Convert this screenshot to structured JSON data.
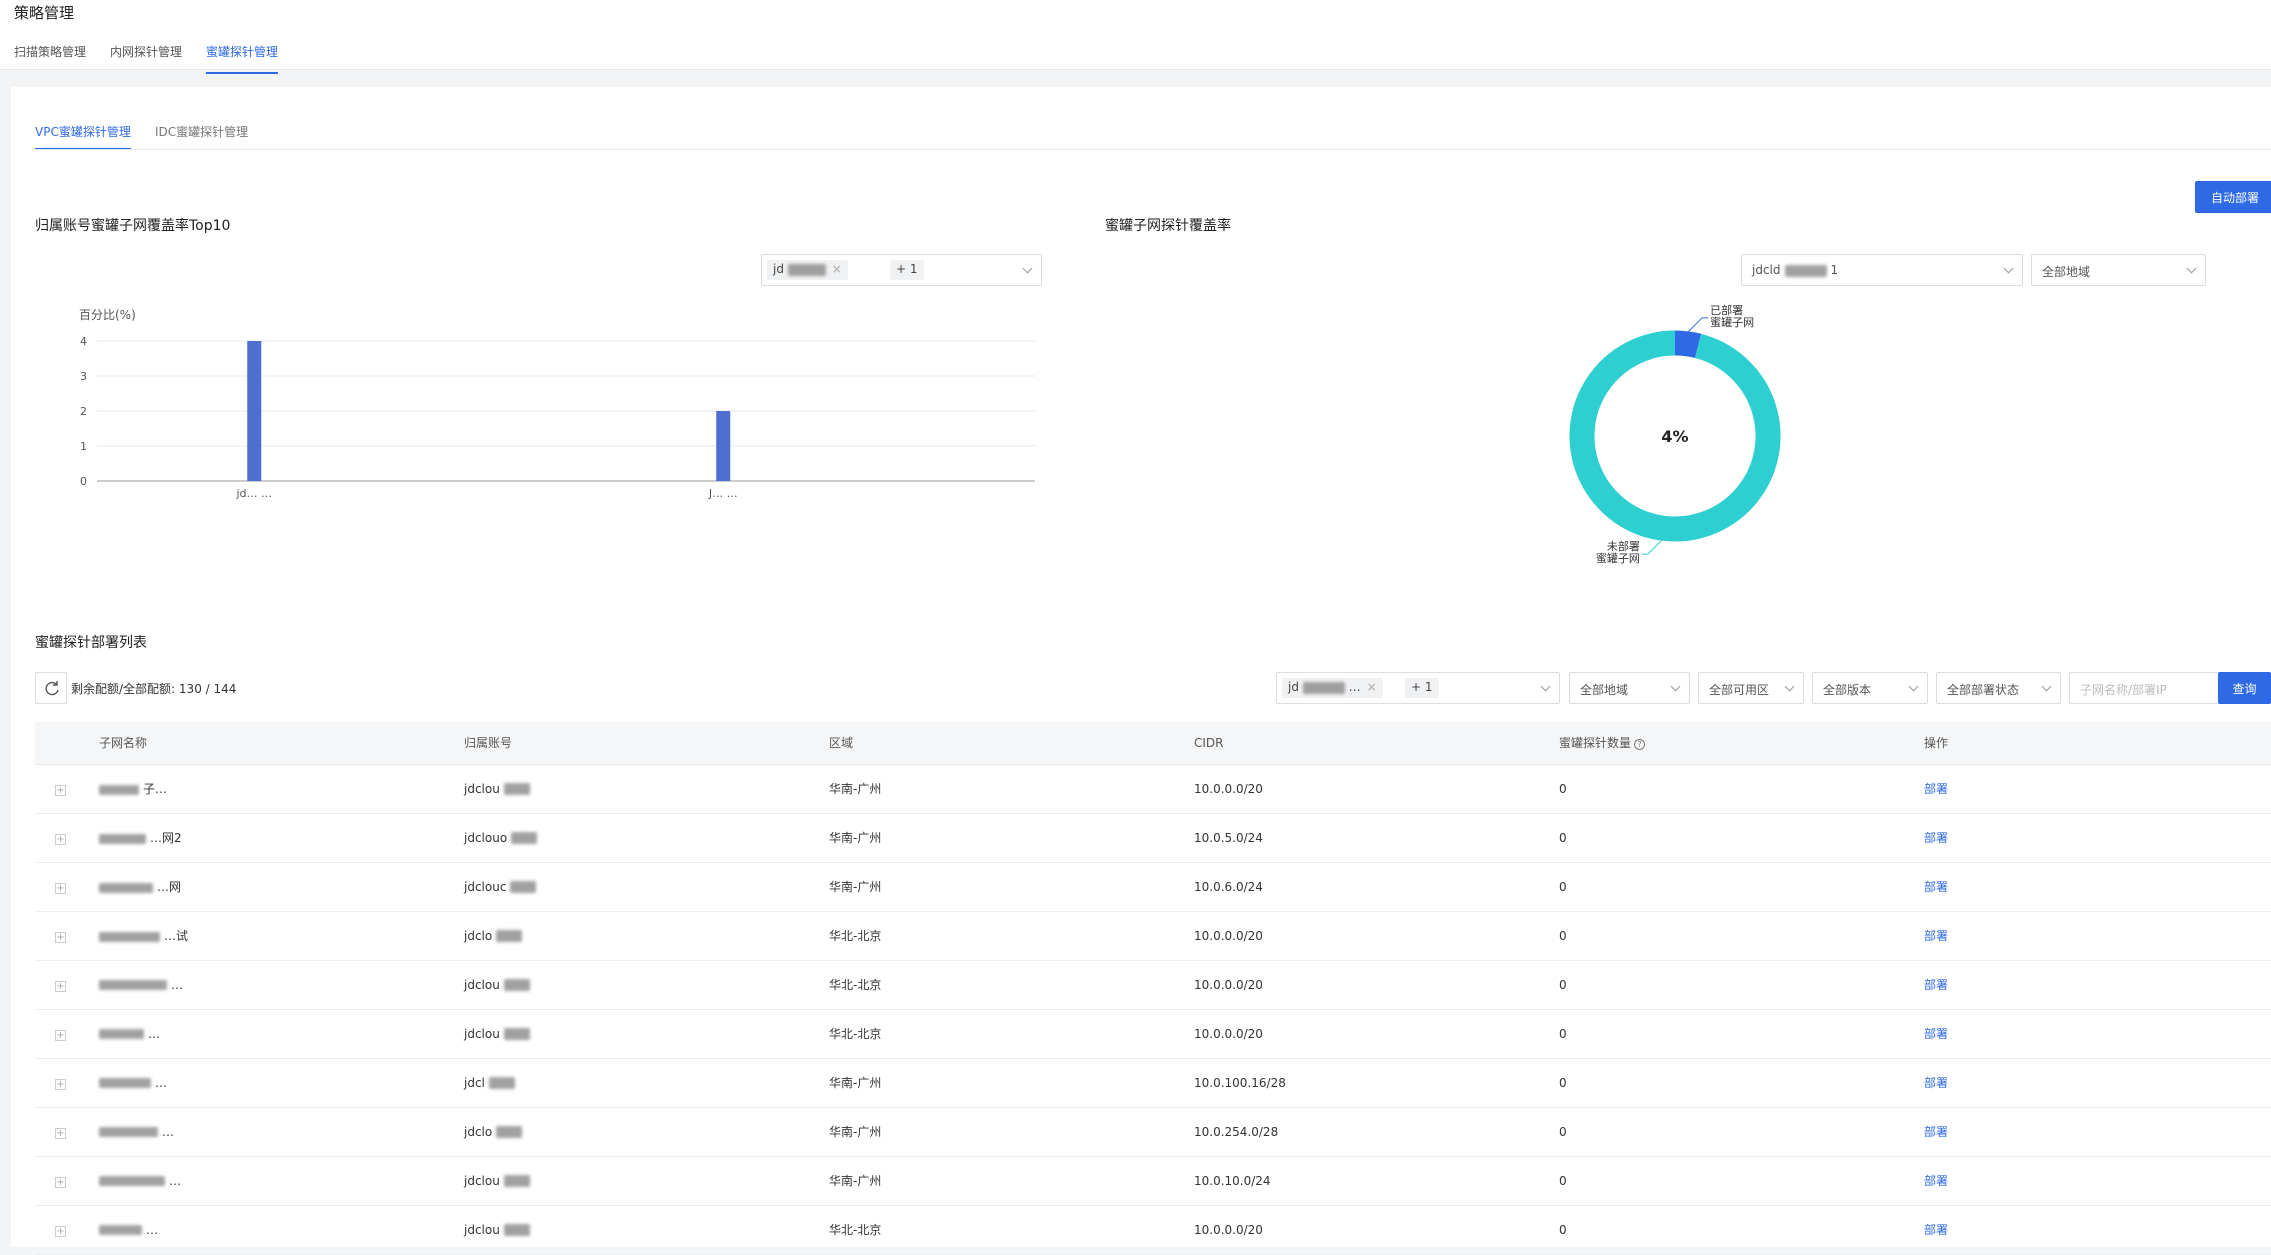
{
  "page": {
    "title": "策略管理"
  },
  "top_tabs": [
    {
      "label": "扫描策略管理",
      "active": false
    },
    {
      "label": "内网探针管理",
      "active": false
    },
    {
      "label": "蜜罐探针管理",
      "active": true
    }
  ],
  "sub_tabs": [
    {
      "label": "VPC蜜罐探针管理",
      "active": true
    },
    {
      "label": "IDC蜜罐探针管理",
      "active": false
    }
  ],
  "auto_deploy_button": "自动部署",
  "bar_section": {
    "title": "归属账号蜜罐子网覆盖率Top10",
    "account_filter": {
      "tag": "jd",
      "more": "+ 1"
    }
  },
  "donut_section": {
    "title": "蜜罐子网探针覆盖率",
    "account_filter": {
      "value": "jdcld",
      "suffix": "1"
    },
    "region_filter": "全部地域"
  },
  "chart_data": [
    {
      "type": "bar",
      "ylabel": "百分比(%)",
      "ylim": [
        0,
        4
      ],
      "yticks": [
        0,
        1,
        2,
        3,
        4
      ],
      "categories": [
        "jd… …",
        "J… …"
      ],
      "values": [
        4,
        2
      ],
      "color": "#4f6fd0",
      "grid": true
    },
    {
      "type": "pie",
      "center_label": "4%",
      "slices": [
        {
          "label": "已部署\n蜜罐子网",
          "value": 4,
          "color": "#2e6ae6"
        },
        {
          "label": "未部署\n蜜罐子网",
          "value": 96,
          "color": "#2ecfd1"
        }
      ]
    }
  ],
  "list_section": {
    "title": "蜜罐探针部署列表",
    "quota_label": "剩余配额/全部配额:",
    "quota_value": "130 / 144",
    "filters": {
      "account_tag": "jd",
      "account_more": "+ 1",
      "region": "全部地域",
      "zone": "全部可用区",
      "version": "全部版本",
      "status": "全部部署状态",
      "search_placeholder": "子网名称/部署IP",
      "search_button": "查询"
    },
    "columns": [
      "子网名称",
      "归属账号",
      "区域",
      "CIDR",
      "蜜罐探针数量",
      "操作"
    ],
    "rows": [
      {
        "name": "子…",
        "account": "jdclou",
        "region": "华南-广州",
        "cidr": "10.0.0.0/20",
        "count": "0",
        "action": "部署"
      },
      {
        "name": "…网2",
        "account": "jdclouo",
        "region": "华南-广州",
        "cidr": "10.0.5.0/24",
        "count": "0",
        "action": "部署"
      },
      {
        "name": "…网",
        "account": "jdclouc",
        "region": "华南-广州",
        "cidr": "10.0.6.0/24",
        "count": "0",
        "action": "部署"
      },
      {
        "name": "…试",
        "account": "jdclo",
        "region": "华北-北京",
        "cidr": "10.0.0.0/20",
        "count": "0",
        "action": "部署"
      },
      {
        "name": "…",
        "account": "jdclou",
        "region": "华北-北京",
        "cidr": "10.0.0.0/20",
        "count": "0",
        "action": "部署"
      },
      {
        "name": "…",
        "account": "jdclou",
        "region": "华北-北京",
        "cidr": "10.0.0.0/20",
        "count": "0",
        "action": "部署"
      },
      {
        "name": "…",
        "account": "jdcl",
        "region": "华南-广州",
        "cidr": "10.0.100.16/28",
        "count": "0",
        "action": "部署"
      },
      {
        "name": "…",
        "account": "jdclo",
        "region": "华南-广州",
        "cidr": "10.0.254.0/28",
        "count": "0",
        "action": "部署"
      },
      {
        "name": "…",
        "account": "jdclou",
        "region": "华南-广州",
        "cidr": "10.0.10.0/24",
        "count": "0",
        "action": "部署"
      },
      {
        "name": "…",
        "account": "jdclou",
        "region": "华北-北京",
        "cidr": "10.0.0.0/20",
        "count": "0",
        "action": "部署"
      }
    ]
  }
}
